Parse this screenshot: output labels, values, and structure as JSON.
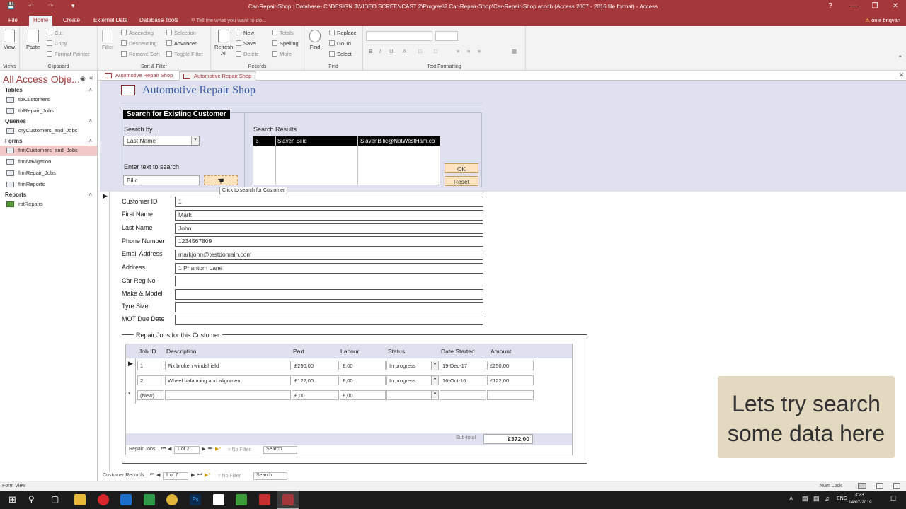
{
  "window": {
    "title": "Car-Repair-Shop : Database- C:\\DESIGN 3\\VIDEO SCREENCAST 2\\Progres\\2.Car-Repair-Shop\\Car-Repair-Shop.accdb (Access 2007 - 2016 file format) - Access",
    "help": "?",
    "minimize": "—",
    "restore": "❐",
    "close": "✕"
  },
  "ribbon_tabs": [
    "File",
    "Home",
    "Create",
    "External Data",
    "Database Tools"
  ],
  "tell_me": "Tell me what you want to do...",
  "user": "onie briqvan",
  "ribbon": {
    "views": {
      "view": "View",
      "group": "Views"
    },
    "clipboard": {
      "paste": "Paste",
      "cut": "Cut",
      "copy": "Copy",
      "format_painter": "Format Painter",
      "group": "Clipboard"
    },
    "sort_filter": {
      "filter": "Filter",
      "ascending": "Ascending",
      "descending": "Descending",
      "remove_sort": "Remove Sort",
      "selection": "Selection",
      "advanced": "Advanced",
      "toggle_filter": "Toggle Filter",
      "group": "Sort & Filter"
    },
    "records": {
      "refresh": "Refresh",
      "refresh_all": "All",
      "new": "New",
      "save": "Save",
      "delete": "Delete",
      "totals": "Totals",
      "spelling": "Spelling",
      "more": "More",
      "group": "Records"
    },
    "find": {
      "find": "Find",
      "replace": "Replace",
      "goto": "Go To",
      "select": "Select",
      "group": "Find"
    },
    "text_formatting": {
      "group": "Text Formatting",
      "bold": "B",
      "italic": "I",
      "underline": "U",
      "font_color": "A"
    }
  },
  "nav_pane": {
    "title": "All Access Obje...",
    "sections": [
      {
        "name": "Tables",
        "items": [
          "tblCustomers",
          "tblRepair_Jobs"
        ]
      },
      {
        "name": "Queries",
        "items": [
          "qryCustomers_and_Jobs"
        ]
      },
      {
        "name": "Forms",
        "items": [
          "frmCustomers_and_Jobs",
          "frmNavigation",
          "frmRepair_Jobs",
          "frmReports"
        ]
      },
      {
        "name": "Reports",
        "items": [
          "rptRepairs"
        ]
      }
    ]
  },
  "doc_tabs": [
    "Automotive Repair Shop",
    "Automotive Repair Shop"
  ],
  "form": {
    "title": "Automotive Repair Shop",
    "search_section": "Search for Existing Customer",
    "search_by_label": "Search by...",
    "search_by_value": "Last Name",
    "enter_text_label": "Enter text to search",
    "search_text_value": "Bilic",
    "tooltip": "Click to search for Customer",
    "results_label": "Search Results",
    "results": [
      {
        "id": "3",
        "name": "Slaven Bilic",
        "email": "SlavenBilic@NotWestHam.co"
      }
    ],
    "ok": "OK",
    "reset": "Reset"
  },
  "customer": {
    "labels": [
      "Customer ID",
      "First Name",
      "Last Name",
      "Phone Number",
      "Email Address",
      "Address",
      "Car Reg No",
      "Make  & Model",
      "Tyre Size",
      "MOT Due Date"
    ],
    "values": [
      "1",
      "Mark",
      "John",
      "1234567809",
      "markjohn@testdomain.com",
      "1 Phantom Lane",
      "",
      "",
      "",
      ""
    ]
  },
  "repair_jobs": {
    "legend": "Repair Jobs for this Customer",
    "headers": [
      "Job ID",
      "Description",
      "Part",
      "Labour",
      "Status",
      "Date Started",
      "Amount"
    ],
    "rows": [
      [
        "1",
        "Fix broken windshield",
        "£250,00",
        "£,00",
        "In progress",
        "19-Dec-17",
        "£250,00"
      ],
      [
        "2",
        "Wheel balancing and alignment",
        "£122,00",
        "£,00",
        "In progress",
        "16-Oct-16",
        "£122,00"
      ],
      [
        "(New)",
        "",
        "£,00",
        "£,00",
        "",
        "",
        ""
      ]
    ],
    "subtotal_label": "Sub-total",
    "subtotal_value": "£372,00",
    "nav": {
      "label": "Repair Jobs",
      "position": "1 of 2",
      "filter": "No Filter",
      "search": "Search"
    }
  },
  "record_nav": {
    "label": "Customer Records",
    "position": "1 of 7",
    "filter": "No Filter",
    "search": "Search"
  },
  "status": {
    "left": "Form View",
    "num_lock": "Num Lock"
  },
  "taskbar": {
    "lang": "ENG",
    "time": "3:23",
    "date": "14/07/2019"
  },
  "overlay": {
    "line1": "Lets try search",
    "line2": "some data here"
  },
  "colors": {
    "accent": "#a4373a",
    "form_header_bg": "#dfe2ee",
    "button_bg": "#fde3bf"
  }
}
